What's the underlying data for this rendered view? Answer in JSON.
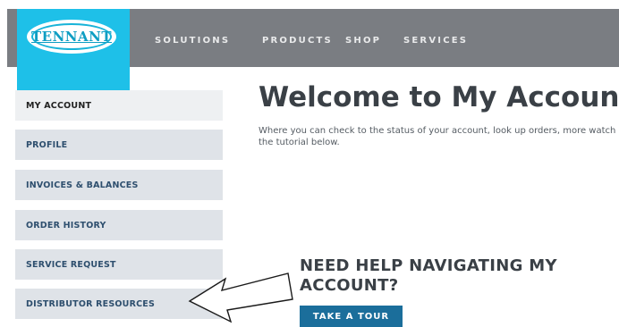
{
  "header": {
    "logo_text": "TENNANT",
    "nav": [
      "SOLUTIONS",
      "PRODUCTS",
      "SHOP",
      "SERVICES"
    ]
  },
  "sidebar": {
    "items": [
      {
        "label": "MY ACCOUNT",
        "active": true
      },
      {
        "label": "PROFILE"
      },
      {
        "label": "INVOICES & BALANCES"
      },
      {
        "label": "ORDER HISTORY"
      },
      {
        "label": "SERVICE REQUEST"
      },
      {
        "label": "DISTRIBUTOR RESOURCES"
      }
    ]
  },
  "main": {
    "title": "Welcome to My Account",
    "intro": "Where you can check to the status of your account, look up orders, more watch the tutorial below.",
    "help_title": "NEED HELP NAVIGATING MY ACCOUNT?",
    "tour_button": "TAKE A TOUR"
  },
  "colors": {
    "header_bg": "#7a7d82",
    "logo_bg": "#1ec0e8",
    "sidebar_bg": "#dfe3e8",
    "sidebar_text": "#2e4f6e",
    "button_bg": "#1b6e9b"
  },
  "icons": {
    "annotation": "arrow-left-icon"
  }
}
